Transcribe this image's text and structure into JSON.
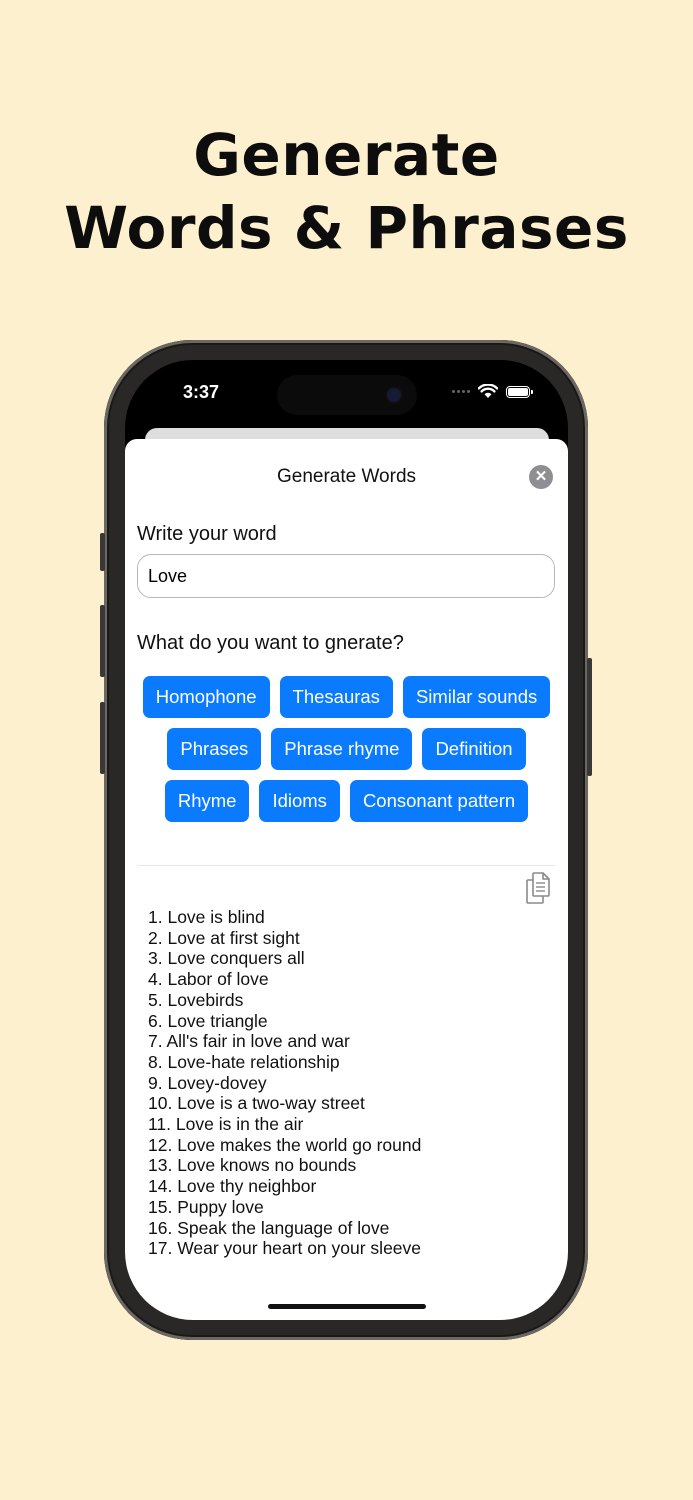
{
  "headline": {
    "line1": "Generate",
    "line2": "Words & Phrases"
  },
  "status_bar": {
    "time": "3:37",
    "icons": [
      "signal-dots-icon",
      "wifi-icon",
      "battery-icon"
    ]
  },
  "sheet": {
    "title": "Generate Words",
    "close_icon": "close-icon",
    "word_label": "Write your word",
    "word_value": "Love",
    "generate_label": "What do you want to gnerate?",
    "options_row1": [
      "Homophone",
      "Thesauras",
      "Similar sounds"
    ],
    "options_row2": [
      "Phrases",
      "Phrase rhyme",
      "Definition"
    ],
    "options_row3": [
      "Rhyme",
      "Idioms",
      "Consonant pattern"
    ],
    "copy_icon": "copy-icon",
    "results": [
      "1. Love is blind",
      "2. Love at first sight",
      "3. Love conquers all",
      "4. Labor of love",
      "5. Lovebirds",
      "6. Love triangle",
      "7. All's fair in love and war",
      "8. Love-hate relationship",
      "9. Lovey-dovey",
      "10. Love is a two-way street",
      "11. Love is in the air",
      "12. Love makes the world go round",
      "13. Love knows no bounds",
      "14. Love thy neighbor",
      "15. Puppy love",
      "16. Speak the language of love",
      "17. Wear your heart on your sleeve"
    ]
  },
  "colors": {
    "background": "#fdf0cf",
    "accent": "#0a7bff",
    "close_button": "#8e8e93"
  }
}
